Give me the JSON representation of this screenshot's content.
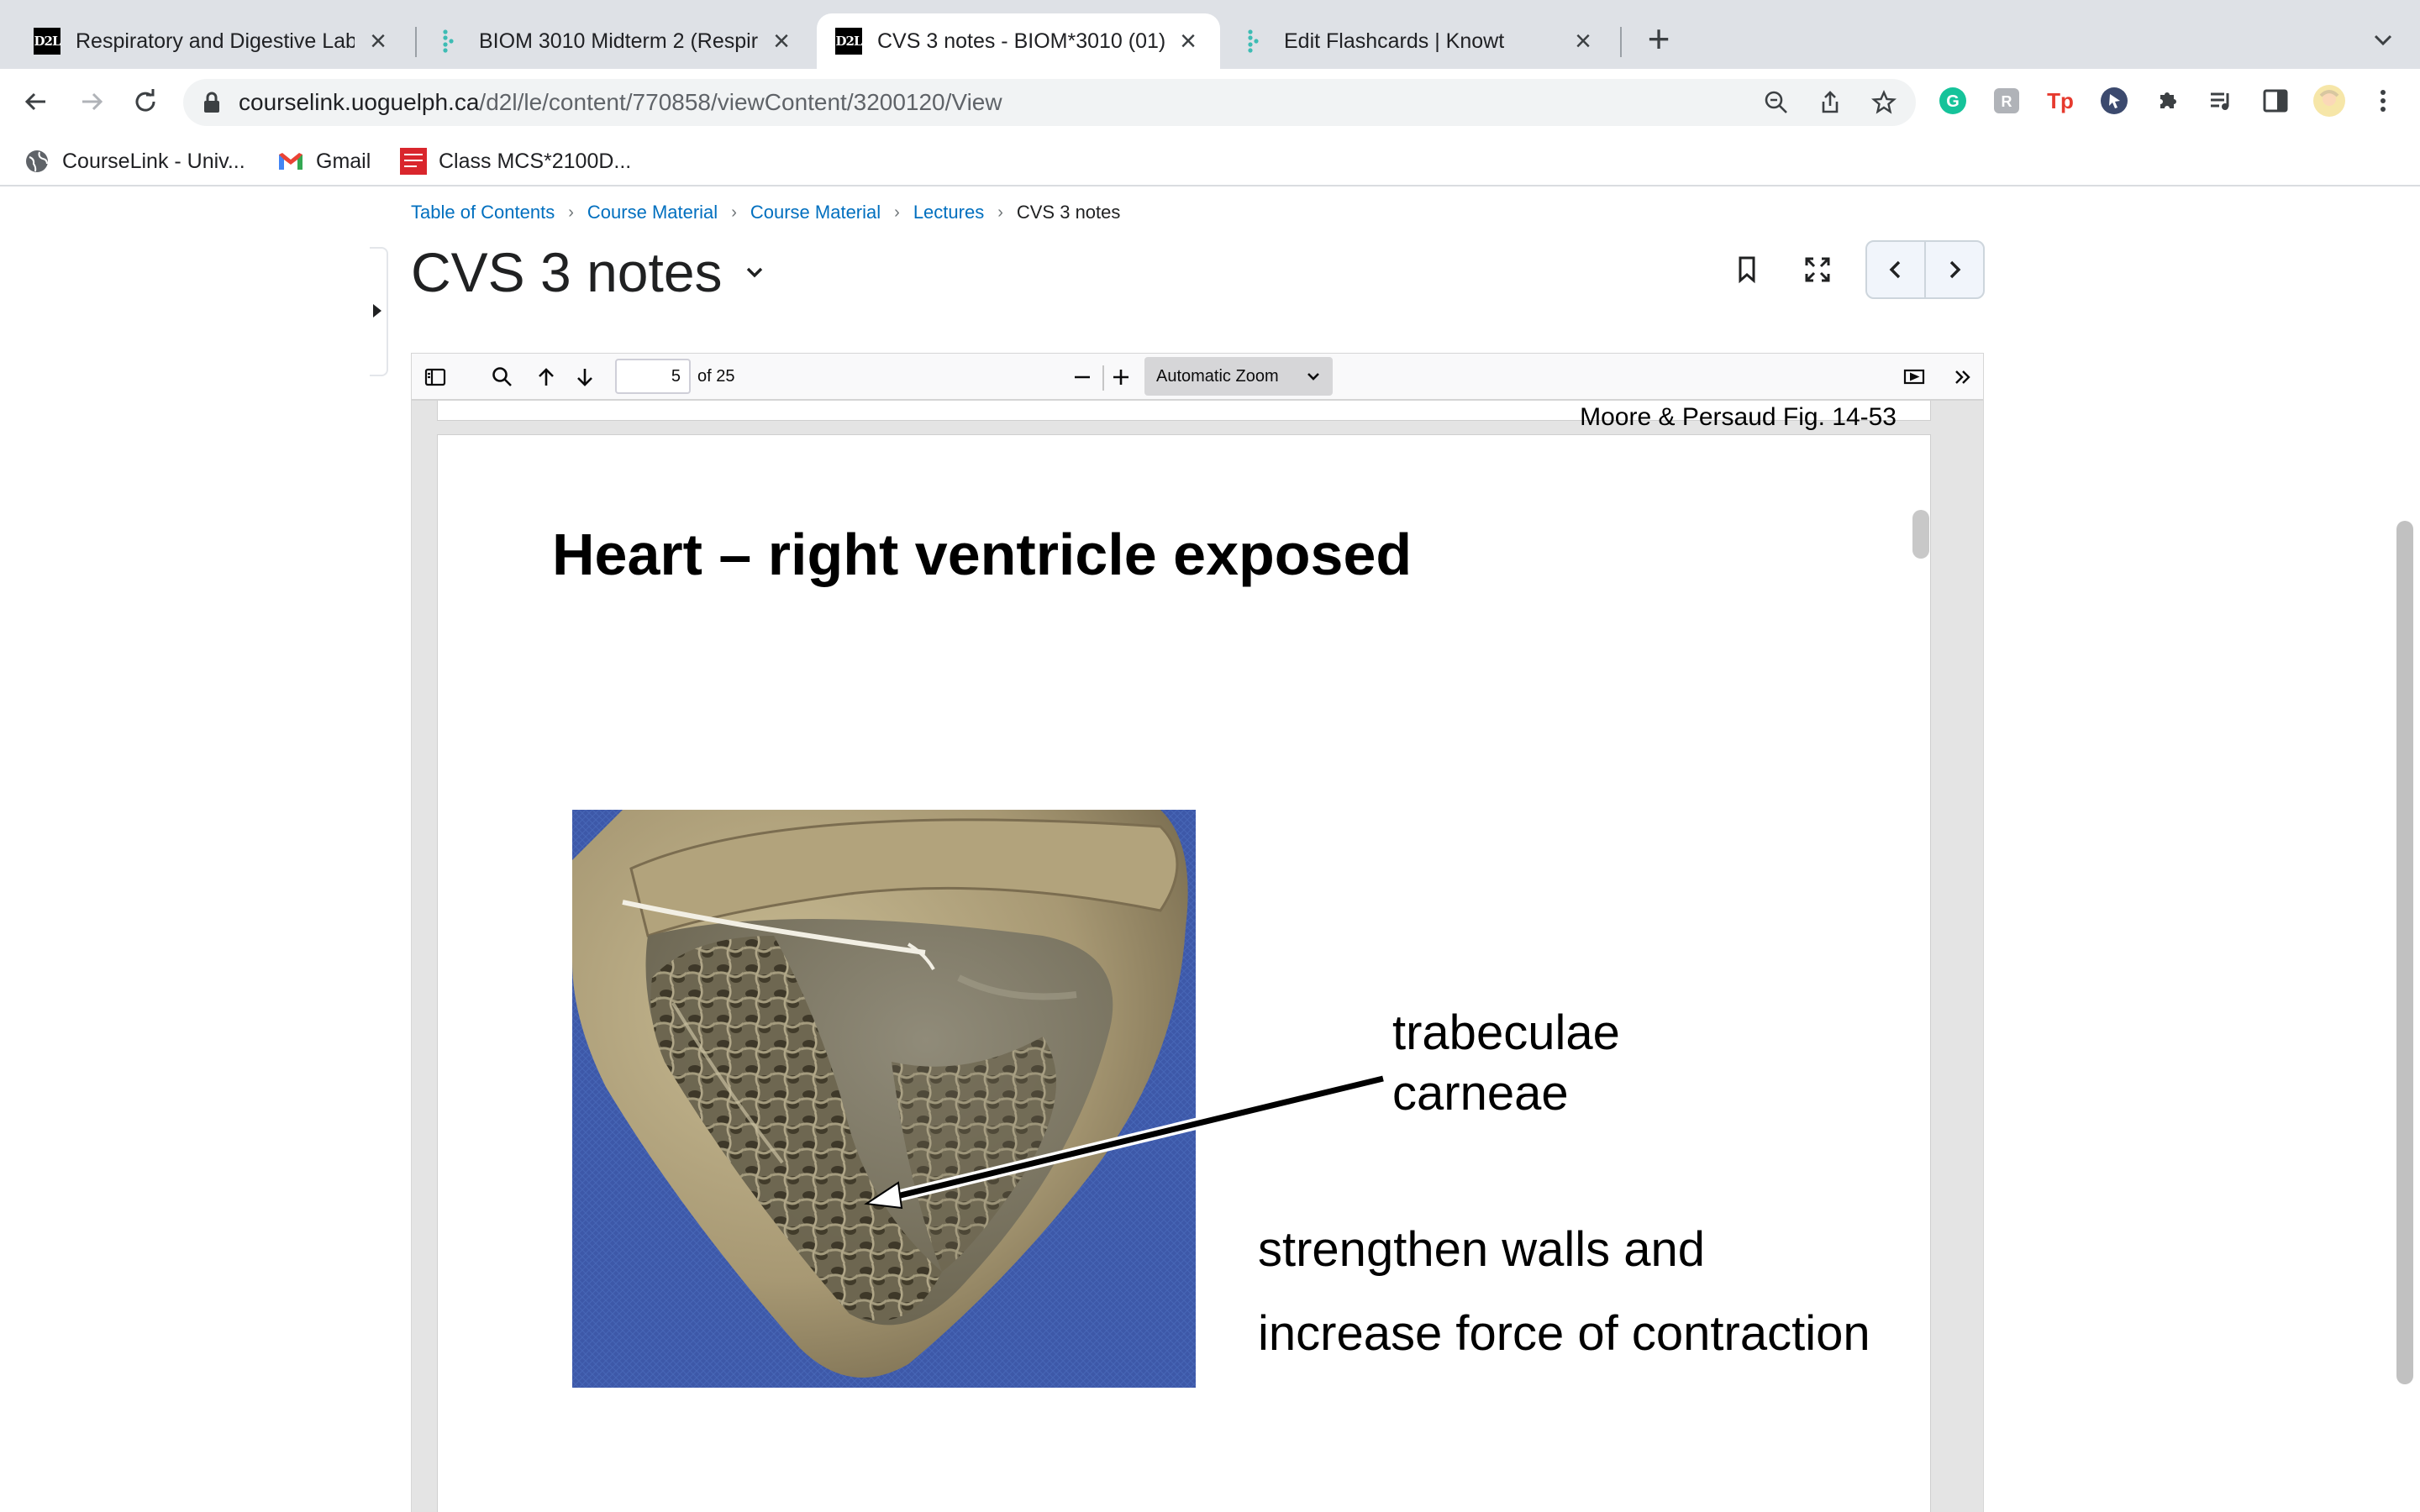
{
  "browser": {
    "tabs": [
      {
        "title": "Respiratory and Digestive Lab",
        "favicon": "d2l-icon",
        "active": false
      },
      {
        "title": "BIOM 3010 Midterm 2 (Respira",
        "favicon": "knowt-icon",
        "active": false
      },
      {
        "title": "CVS 3 notes - BIOM*3010 (01)",
        "favicon": "d2l-icon",
        "active": true
      },
      {
        "title": "Edit Flashcards | Knowt",
        "favicon": "knowt-icon",
        "active": false
      }
    ],
    "address": {
      "domain": "courselink.uoguelph.ca",
      "path": "/d2l/le/content/770858/viewContent/3200120/View"
    },
    "bookmarks": [
      {
        "label": "CourseLink - Univ...",
        "icon": "globe-icon"
      },
      {
        "label": "Gmail",
        "icon": "gmail-icon"
      },
      {
        "label": "Class MCS*2100D...",
        "icon": "mcgraw-hill-icon"
      }
    ],
    "favicon_text": "D2L"
  },
  "breadcrumb": {
    "items": [
      "Table of Contents",
      "Course Material",
      "Course Material",
      "Lectures"
    ],
    "current": "CVS 3 notes"
  },
  "doc": {
    "title": "CVS 3 notes"
  },
  "pdf": {
    "page_number": "5",
    "page_count": "of 25",
    "zoom": "Automatic Zoom",
    "prev_caption": "Moore & Persaud Fig. 14-53",
    "slide": {
      "title": "Heart – right ventricle exposed",
      "label_line1": "trabeculae",
      "label_line2": "carneae",
      "note_line1": "strengthen walls and",
      "note_line2": "increase force of contraction"
    }
  },
  "colors": {
    "link": "#006fbf",
    "tab_strip": "#dee1e6",
    "slide_bg_blue": "#3b56a8"
  }
}
